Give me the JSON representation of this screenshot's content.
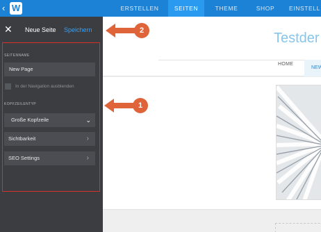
{
  "topbar": {
    "tabs": [
      {
        "label": "ERSTELLEN"
      },
      {
        "label": "SEITEN"
      },
      {
        "label": "THEME"
      },
      {
        "label": "SHOP"
      },
      {
        "label": "EINSTELL"
      }
    ],
    "active_tab": "SEITEN",
    "colors": {
      "bar": "#1b82d6",
      "active": "#2a9af0"
    }
  },
  "sidebar": {
    "title": "Neue Seite",
    "save_label": "Speichern",
    "page_name_label": "SEITENNAME",
    "page_name_value": "New Page",
    "hide_nav_label": "In der Navigation ausblenden",
    "hide_nav_checked": false,
    "header_type_label": "KOPFZEILENTYP",
    "header_type_value": "Große Kopfzeile",
    "visibility_label": "Sichtbarkeit",
    "seo_label": "SEO Settings",
    "colors": {
      "background": "#3b3d41",
      "highlight_border": "#d9302b"
    }
  },
  "annotations": [
    {
      "number": "1"
    },
    {
      "number": "2"
    }
  ],
  "preview": {
    "site_title": "Testder",
    "nav_home": "HOME",
    "nav_new": "NEW"
  }
}
